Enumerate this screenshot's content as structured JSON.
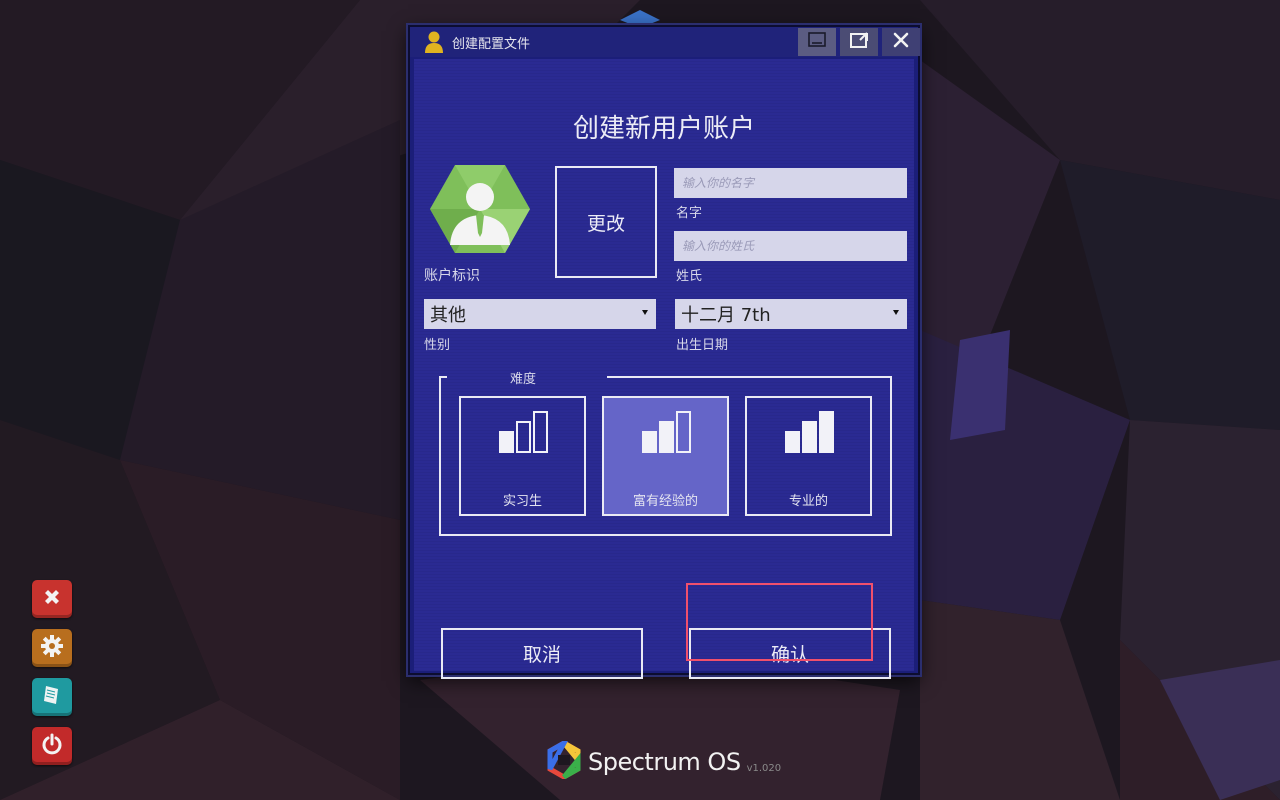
{
  "window": {
    "title": "创建配置文件",
    "heading": "创建新用户账户",
    "controls": {
      "minimize_icon": "minimize-icon",
      "restore_icon": "restore-icon",
      "close_icon": "close-icon"
    }
  },
  "profile": {
    "avatar_icon": "user-avatar-hexagon-icon",
    "avatar_label": "账户标识",
    "change_button": "更改",
    "first_name": {
      "placeholder": "输入你的名字",
      "value": "",
      "label": "名字"
    },
    "last_name": {
      "placeholder": "输入你的姓氏",
      "value": "",
      "label": "姓氏"
    },
    "gender": {
      "value": "其他",
      "label": "性别"
    },
    "birthday": {
      "value": "十二月 7th",
      "label": "出生日期"
    }
  },
  "difficulty": {
    "legend": "难度",
    "options": [
      {
        "label": "实习生",
        "icon": "signal-low-icon",
        "selected": false
      },
      {
        "label": "富有经验的",
        "icon": "signal-medium-icon",
        "selected": true
      },
      {
        "label": "专业的",
        "icon": "signal-high-icon",
        "selected": false
      }
    ]
  },
  "actions": {
    "cancel": "取消",
    "confirm": "确认"
  },
  "dock": [
    {
      "icon": "close-x-icon",
      "color": "#c8332e"
    },
    {
      "icon": "gear-icon",
      "color": "#b86e1e"
    },
    {
      "icon": "scroll-icon",
      "color": "#1f9aa0"
    },
    {
      "icon": "power-icon",
      "color": "#c22a2a"
    }
  ],
  "brand": {
    "name": "Spectrum OS",
    "version": "v1.020",
    "logo_icon": "spectrum-hexagon-logo-icon"
  },
  "colors": {
    "window_bg": "#2a2a92",
    "titlebar": "#20237a",
    "selected_card": "#6565c8",
    "input_bg": "#d6d6ea",
    "highlight": "#f0506c"
  }
}
